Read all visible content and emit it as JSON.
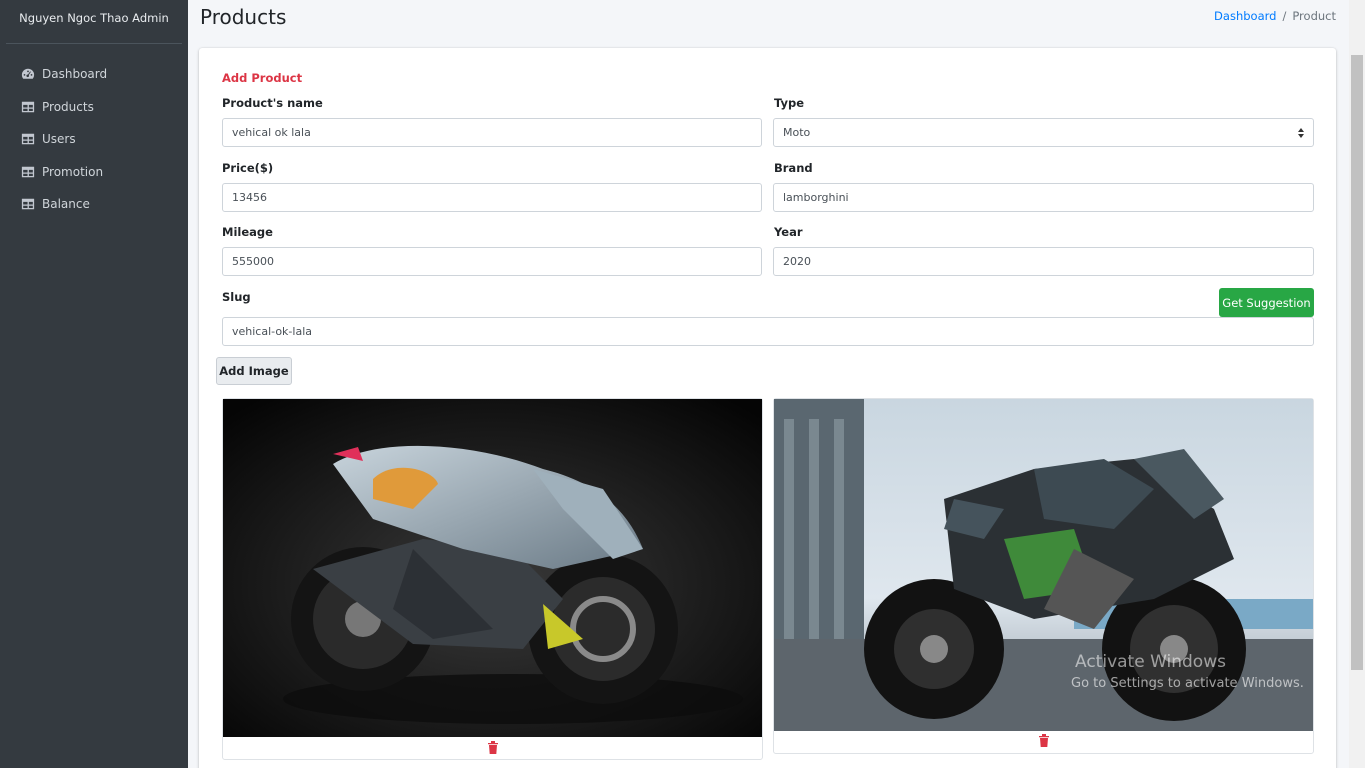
{
  "sidebar": {
    "brand": "Nguyen Ngoc Thao Admin",
    "items": [
      {
        "label": "Dashboard",
        "icon": "dashboard-icon"
      },
      {
        "label": "Products",
        "icon": "table-icon"
      },
      {
        "label": "Users",
        "icon": "table-icon"
      },
      {
        "label": "Promotion",
        "icon": "table-icon"
      },
      {
        "label": "Balance",
        "icon": "table-icon"
      }
    ]
  },
  "header": {
    "title": "Products",
    "breadcrumb": {
      "link": "Dashboard",
      "separator": "/",
      "current": "Product"
    }
  },
  "form": {
    "title": "Add Product",
    "name_label": "Product's name",
    "name_value": "vehical ok lala",
    "type_label": "Type",
    "type_value": "Moto",
    "price_label": "Price($)",
    "price_value": "13456",
    "brand_label": "Brand",
    "brand_value": "lamborghini",
    "mileage_label": "Mileage",
    "mileage_value": "555000",
    "year_label": "Year",
    "year_value": "2020",
    "slug_label": "Slug",
    "slug_value": "vehical-ok-lala",
    "suggest_button": "Get Suggestion",
    "add_image_button": "Add Image"
  },
  "images": [
    {
      "subject": "motorcycle-photo-dark-studio"
    },
    {
      "subject": "motorcycle-photo-outdoor-green"
    }
  ],
  "watermark": {
    "line1": "Activate Windows",
    "line2": "Go to Settings to activate Windows."
  },
  "colors": {
    "accent": "#007bff",
    "danger": "#dc3545",
    "success": "#28a745",
    "sidebar": "#343a40"
  }
}
